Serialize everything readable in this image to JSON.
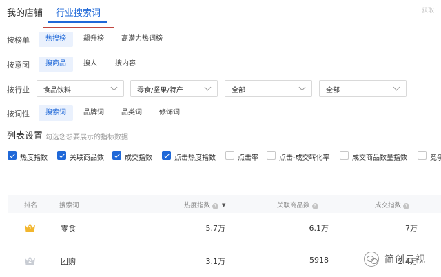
{
  "tabs": {
    "my_store": "我的店铺",
    "industry_search": "行业搜索词",
    "faded_right": "获取"
  },
  "filters": {
    "by_list": {
      "label": "按榜单",
      "options": [
        "热搜榜",
        "飙升榜",
        "高潜力热词榜"
      ],
      "selected": "热搜榜"
    },
    "by_intent": {
      "label": "按意图",
      "options": [
        "搜商品",
        "搜人",
        "搜内容"
      ],
      "selected": "搜商品"
    },
    "by_industry": {
      "label": "按行业",
      "selects": [
        "食品饮料",
        "零食/坚果/特产",
        "全部",
        "全部"
      ]
    },
    "by_wordtype": {
      "label": "按词性",
      "options": [
        "搜索词",
        "品牌词",
        "品类词",
        "修饰词"
      ],
      "selected": "搜索词"
    }
  },
  "list_settings": {
    "title": "列表设置",
    "hint": "勾选您想要展示的指标数据",
    "checkboxes": [
      {
        "label": "热度指数",
        "checked": true
      },
      {
        "label": "关联商品数",
        "checked": true
      },
      {
        "label": "成交指数",
        "checked": true
      },
      {
        "label": "点击热度指数",
        "checked": true
      },
      {
        "label": "点击率",
        "checked": false
      },
      {
        "label": "点击-成交转化率",
        "checked": false
      },
      {
        "label": "成交商品数量指数",
        "checked": false
      },
      {
        "label": "竞争",
        "checked": false
      }
    ]
  },
  "table": {
    "headers": {
      "rank": "排名",
      "keyword": "搜索词",
      "heat": "热度指数",
      "related": "关联商品数",
      "deal": "成交指数"
    },
    "rows": [
      {
        "rank": "1",
        "keyword": "零食",
        "heat": "5.7万",
        "related": "6.1万",
        "deal": "7万"
      },
      {
        "rank": "2",
        "keyword": "团购",
        "heat": "3.1万",
        "related": "5918",
        "deal": "2.4万"
      }
    ]
  },
  "watermark": {
    "text": "简创云视"
  },
  "colors": {
    "accent": "#1f68d8",
    "highlight_border": "#c0463f",
    "chip_bg": "#eaf1fd",
    "gold": "#f2b62e",
    "silver": "#c9cdd4"
  },
  "icons": [
    "question-icon",
    "sort-desc-icon",
    "chevron-down-icon",
    "crown-icon",
    "wechat-icon"
  ]
}
